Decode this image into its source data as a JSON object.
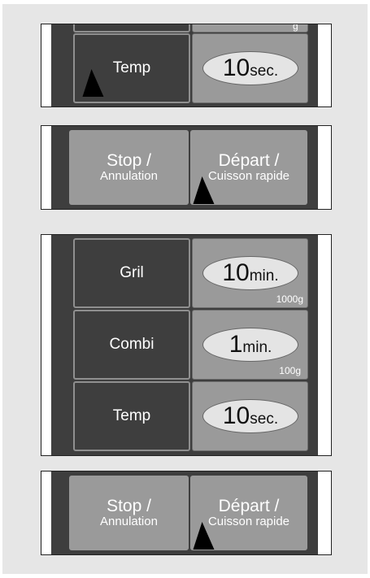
{
  "panel1": {
    "weight_fragment": "g",
    "temp_label": "Temp",
    "temp_value": "10",
    "temp_unit": "sec."
  },
  "panel2": {
    "stop_line1": "Stop /",
    "stop_line2": "Annulation",
    "start_line1": "Départ /",
    "start_line2": "Cuisson rapide"
  },
  "panel3": {
    "rows": [
      {
        "label": "Gril",
        "value": "10",
        "unit": "min.",
        "sub": "1000g"
      },
      {
        "label": "Combi",
        "value": "1",
        "unit": "min.",
        "sub": "100g"
      },
      {
        "label": "Temp",
        "value": "10",
        "unit": "sec.",
        "sub": ""
      }
    ]
  },
  "panel4": {
    "stop_line1": "Stop /",
    "stop_line2": "Annulation",
    "start_line1": "Départ /",
    "start_line2": "Cuisson rapide"
  }
}
